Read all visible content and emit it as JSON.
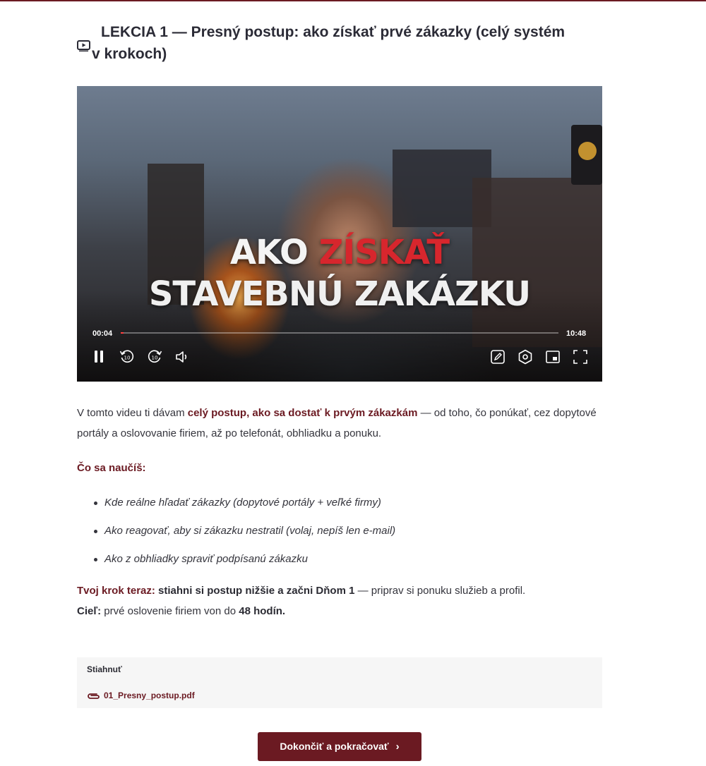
{
  "lesson": {
    "title_line1": "LEKCIA 1 — Presný postup: ako získať prvé zákazky (celý systém",
    "title_line2": "v krokoch)"
  },
  "video": {
    "overlay_word1": "AKO",
    "overlay_word2": "ZÍSKAŤ",
    "overlay_line2": "STAVEBNÚ ZAKÁZKU",
    "current_time": "00:04",
    "duration": "10:48",
    "progress_fraction": 0.0062,
    "controls": [
      "pause-icon",
      "rewind-10-icon",
      "forward-10-icon",
      "volume-icon",
      "edit-icon",
      "settings-icon",
      "picture-in-picture-icon",
      "fullscreen-icon"
    ],
    "colors": {
      "overlay_accent": "#d7262d",
      "progress": "#ff4040"
    }
  },
  "intro": {
    "text_before": "V tomto videu ti dávam ",
    "highlight": "celý postup, ako sa dostať k prvým zákazkám",
    "text_after": " — od toho, čo ponúkať, cez dopytové portály a oslovovanie firiem, až po telefonát, obhliadku a ponuku."
  },
  "learn": {
    "heading": "Čo sa naučíš:",
    "items": [
      "Kde reálne hľadať zákazky (dopytové portály + veľké firmy)",
      "Ako reagovať, aby si zákazku nestratil (volaj, nepíš len e-mail)",
      "Ako z obhliadky spraviť podpísanú zákazku"
    ]
  },
  "step": {
    "label": "Tvoj krok teraz:",
    "bold": "stiahni si postup nižšie a začni Dňom 1",
    "rest": " — priprav si ponuku služieb a profil.",
    "goal_label": "Cieľ:",
    "goal_text": " prvé oslovenie firiem von do ",
    "goal_bold": "48 hodín."
  },
  "download": {
    "heading": "Stiahnuť",
    "file": "01_Presny_postup.pdf"
  },
  "cta": {
    "label": "Dokončiť a pokračovať",
    "chevron": "›"
  },
  "theme": {
    "accent": "#6b1a22",
    "text": "#34343c",
    "download_bg": "#f6f6f6"
  }
}
